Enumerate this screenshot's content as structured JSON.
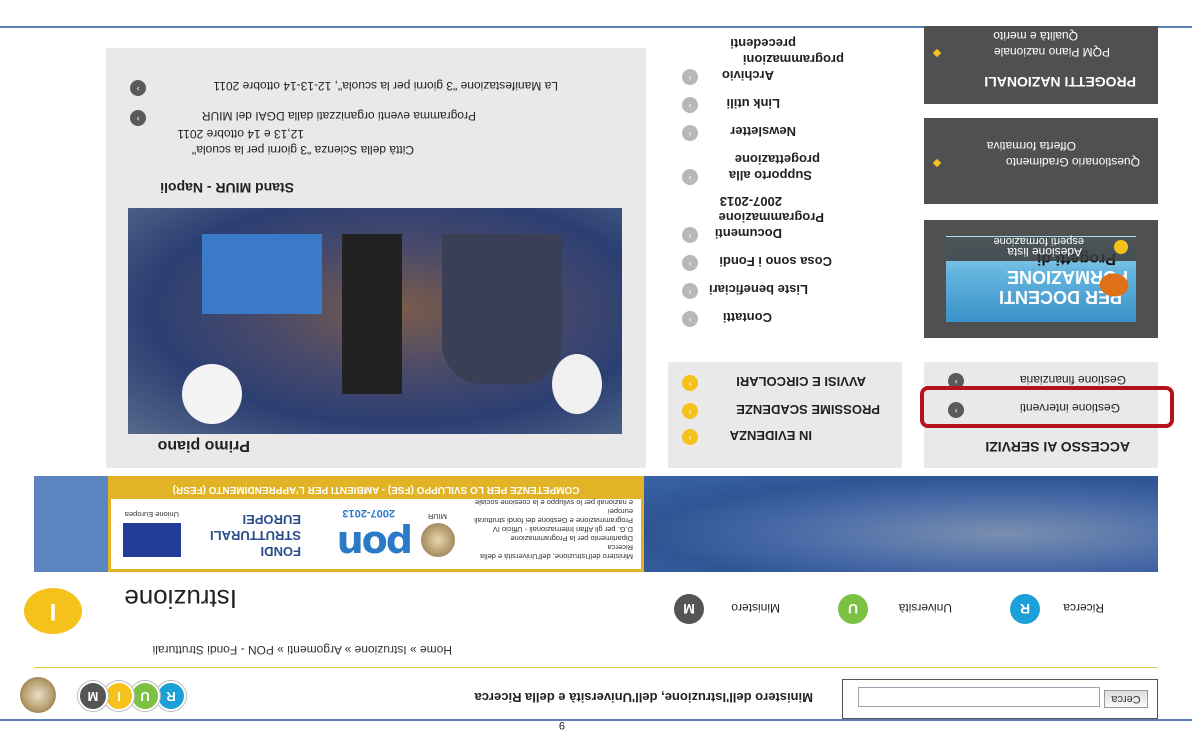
{
  "header": {
    "search_button": "Cerca",
    "search_placeholder": "",
    "ministry_title": "Ministero dell'Istruzione, dell'Università e della Ricerca",
    "badges": [
      "M",
      "I",
      "U",
      "R"
    ],
    "colors": {
      "m": "#555555",
      "i": "#f4c21b",
      "u": "#7cc242",
      "r": "#1ba0d7"
    }
  },
  "breadcrumb": "Home » Istruzione » Argomenti » PON - Fondi Strutturali",
  "section": {
    "title": "Istruzione",
    "icon_letter": "I",
    "nav": [
      {
        "letter": "M",
        "label": "Ministero",
        "color": "#555555"
      },
      {
        "letter": "U",
        "label": "Università",
        "color": "#7cc242"
      },
      {
        "letter": "R",
        "label": "Ricerca",
        "color": "#1ba0d7"
      }
    ]
  },
  "banner": {
    "strip": "COMPETENZE PER LO SVILUPPO (FSE) - AMBIENTI PER L'APPRENDIMENTO (FESR)",
    "fondi": "FONDI",
    "strutturali": "STRUTTURALI",
    "europei": "EUROPEI",
    "pon": "pon",
    "pon_years": "2007-2013",
    "eu_label": "Unione Europea",
    "miur": "MIUR",
    "ministry_lines": [
      "Ministero dell'Istruzione, dell'Università e della Ricerca",
      "Dipartimento per la Programmazione",
      "D.G. per gli Affari Internazionali - Ufficio IV",
      "Programmazione e Gestione dei fondi strutturali europei",
      "e nazionali per lo sviluppo e la coesione sociale"
    ]
  },
  "primo_piano": {
    "title": "Primo piano",
    "stand_title": "Stand MIUR - Napoli",
    "stand_lines": [
      "Città della Scienza \"3 giorni per la scuola\"",
      "12,13 e 14 ottobre 2011"
    ],
    "items": [
      "Programma eventi organizzati dalla DGAI del MIUR",
      "La Manifestazione \"3 giorni per la scuola\", 12-13-14 ottobre 2011"
    ]
  },
  "evidenza": {
    "items": [
      "IN EVIDENZA",
      "PROSSIME SCADENZE",
      "AVVISI E CIRCOLARI"
    ]
  },
  "menu": {
    "items": [
      "Contatti",
      "Liste beneficiari",
      "Cosa sono i Fondi",
      "Documenti",
      "Programmazione",
      "2007-2013",
      "Supporto alla",
      "progettazione",
      "Newsletter",
      "Link utili",
      "Archivio",
      "programmazioni",
      "precedenti"
    ]
  },
  "accesso": {
    "title": "ACCESSO AI SERVIZI",
    "items": [
      "Gestione interventi",
      "Gestione finanziaria"
    ]
  },
  "formazione": {
    "line1": "Progetti di",
    "line2": "FORMAZIONE",
    "line3": "PER DOCENTI",
    "adesione1": "Adesione lista",
    "adesione2": "esperti formazione"
  },
  "questionario": {
    "item1": "Questionario Gradimento",
    "item2": "Offerta formativa"
  },
  "progetti": {
    "title": "PROGETTI NAZIONALI",
    "item1": "PQM Piano nazionale",
    "item2": "Qualità e merito"
  },
  "page_number": "9"
}
